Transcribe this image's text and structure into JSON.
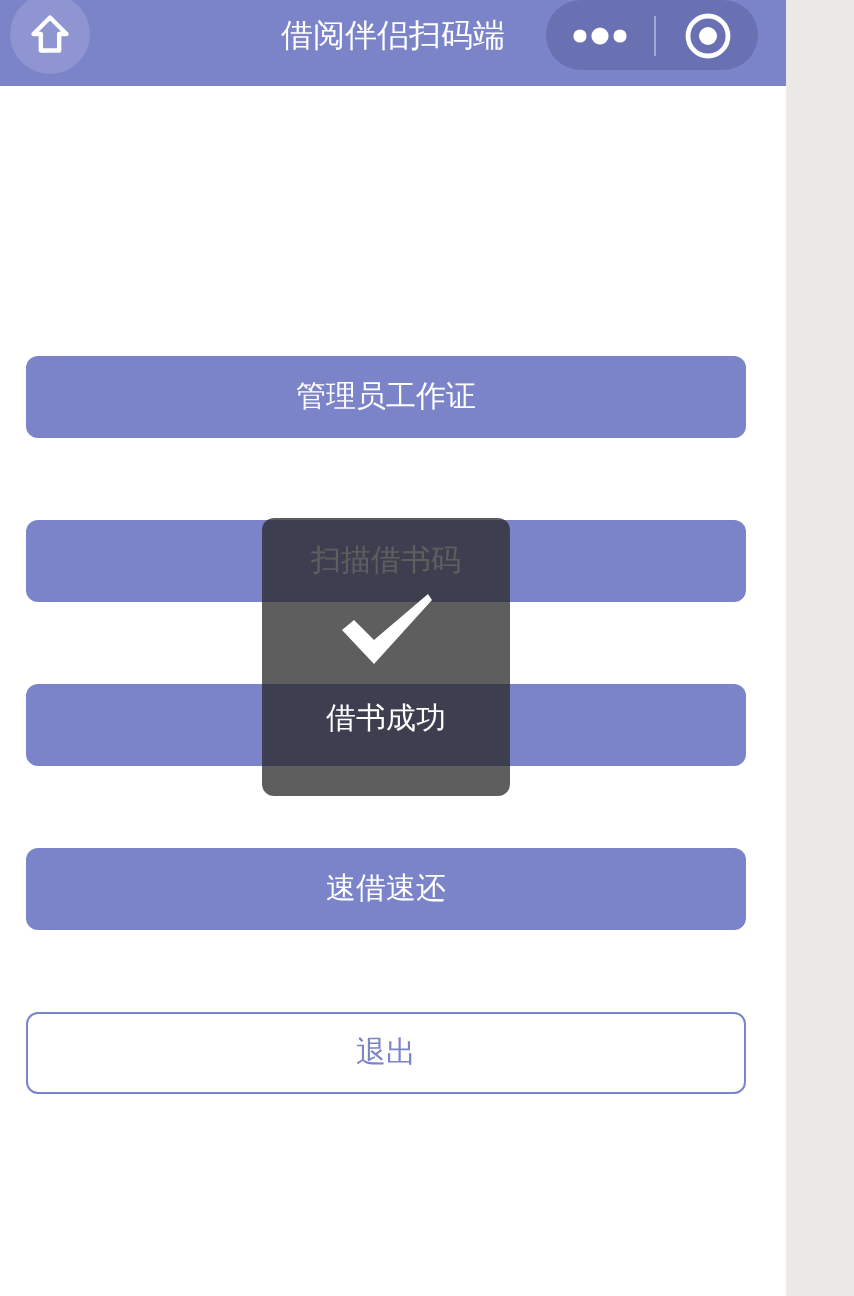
{
  "nav_bar": {
    "title": "借阅伴侣扫码端"
  },
  "buttons": [
    {
      "label": "管理员工作证",
      "kind": "filled"
    },
    {
      "label": "扫描借书码",
      "kind": "filled"
    },
    {
      "kind": "filled"
    },
    {
      "label": "速借速还",
      "kind": "filled"
    },
    {
      "label": "退出",
      "kind": "outline"
    }
  ],
  "toast": {
    "message": "借书成功"
  }
}
